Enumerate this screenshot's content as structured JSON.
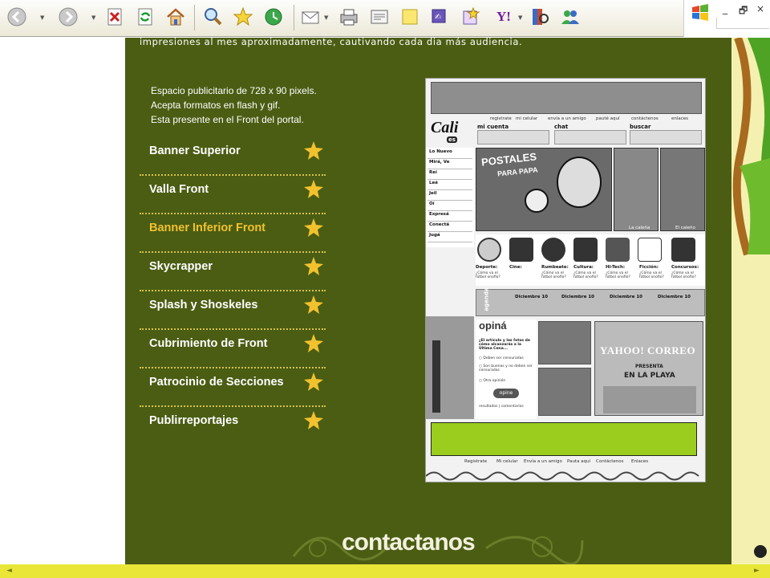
{
  "browser": {
    "toolbar_icons": [
      "back-icon",
      "forward-icon",
      "stop-icon",
      "refresh-icon",
      "home-icon",
      "search-icon",
      "favorites-icon",
      "history-icon",
      "mail-icon",
      "print-icon",
      "edit-icon",
      "notes-icon",
      "messenger-icon",
      "bookmark-icon",
      "yahoo-icon",
      "research-icon",
      "people-icon"
    ],
    "yahoo_label": "Y!",
    "window_controls": {
      "minimize": "_",
      "restore": "🗗",
      "close": "×"
    }
  },
  "colors": {
    "main_bg": "#4a5d13",
    "highlight": "#f2c12e",
    "star": "#f2c12e",
    "bottom_bar": "#e9e638",
    "mock_green": "#9acd1d"
  },
  "intro": "impresiones al mes aproximadamente, cautivando cada dia más audiencia.",
  "description": [
    "Espacio publicitario de 728 x 90 pixels.",
    "Acepta formatos en flash y gif.",
    "Esta presente en el Front del portal."
  ],
  "menu": [
    {
      "label": "Banner Superior",
      "active": false
    },
    {
      "label": "Valla Front",
      "active": false
    },
    {
      "label": "Banner Inferior Front",
      "active": true
    },
    {
      "label": "Skycrapper",
      "active": false
    },
    {
      "label": "Splash y Shoskeles",
      "active": false
    },
    {
      "label": "Cubrimiento de Front",
      "active": false
    },
    {
      "label": "Patrocinio de Secciones",
      "active": false
    },
    {
      "label": "Publirreportajes",
      "active": false
    }
  ],
  "contact_label": "contactanos",
  "mockup": {
    "top_links": [
      "registrate",
      "mi celular",
      "envía a un amigo",
      "pauté aquí",
      "contáctenos",
      "enlaces"
    ],
    "logo": "Cali",
    "logo_sub": "es",
    "mi_cuenta": "mi cuenta",
    "chat": "chat",
    "buscar": "buscar",
    "side_menu": [
      "Lo Nuevo",
      "Mirá, Ve",
      "Reí",
      "Leé",
      "Jeil",
      "Oí",
      "Expresá",
      "Conectá",
      "Jugá"
    ],
    "postales": [
      "POSTALES",
      "PARA PAPA"
    ],
    "photo_captions": [
      "La caleña",
      "El caleño"
    ],
    "categories": [
      "Deporte:",
      "Cine:",
      "Rumbeate:",
      "Cultura:",
      "Hi-Tech:",
      "Ficción:",
      "Concursos:"
    ],
    "category_question": "¿Cómo va el fútbol onofio?",
    "agenda_label": "agenda",
    "agenda": [
      "Diciembre 10",
      "Diciembre 10",
      "Diciembre 10",
      "Diciembre 10"
    ],
    "opina_label": "opiná",
    "opina_question": "¿El artículo y las fotos de cómo alcanzarás a la Última Cena...",
    "opina_options": [
      "Deben ser censuradas",
      "Son buenas y no deben ser censuradas",
      "Otra opinión"
    ],
    "opina_button": "opine",
    "opina_footer": "resultados | comentarios",
    "yahoo_ad": [
      "YAHOO! CORREO",
      "PRESENTA",
      "EN LA PLAYA"
    ],
    "footer_links": [
      "Registrate",
      "Mi celular",
      "Envía a un amigo",
      "Pauta aquí",
      "Contáctenos",
      "Enlaces"
    ]
  }
}
